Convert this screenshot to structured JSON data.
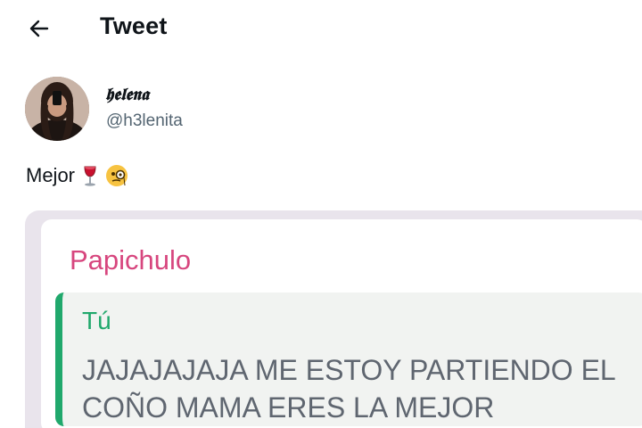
{
  "header": {
    "back_icon": "arrow-left-icon",
    "title": "Tweet"
  },
  "author": {
    "display_name": "𝖍𝖊𝖑𝖊𝖓𝖆",
    "handle": "@h3lenita",
    "avatar_icon": "avatar"
  },
  "tweet": {
    "text": "Mejor",
    "emojis": [
      "wine-glass-icon",
      "monocle-face-icon"
    ]
  },
  "media": {
    "sender": "Papichulo",
    "quote_author": "Tú",
    "quote_text": "JAJAJAJAJA ME ESTOY PARTIENDO EL COÑO MAMA ERES LA MEJOR"
  },
  "colors": {
    "sender": "#d7467e",
    "quote_accent": "#20a86c"
  }
}
